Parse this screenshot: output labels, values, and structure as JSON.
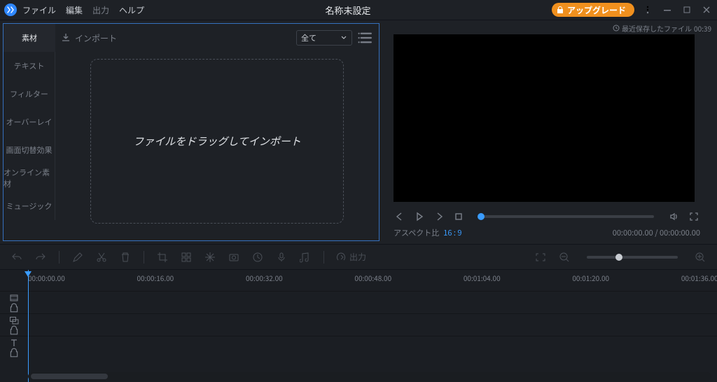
{
  "menubar": {
    "items": [
      "ファイル",
      "編集",
      "出力",
      "ヘルプ"
    ],
    "disabled_index": 2
  },
  "title": "名称未設定",
  "upgrade_label": "アップグレード",
  "recent_saved": {
    "label": "最近保存したファイル",
    "time": "00:39"
  },
  "side_tabs": [
    "素材",
    "テキスト",
    "フィルター",
    "オーバーレイ",
    "画面切替効果",
    "オンライン素材",
    "ミュージック"
  ],
  "active_side_tab": 0,
  "left_panel": {
    "import_label": "インポート",
    "filter_selected": "全て",
    "drop_hint": "ファイルをドラッグしてインポート"
  },
  "player": {
    "aspect_label": "アスペクト比",
    "aspect_value": "16 : 9",
    "time_current": "00:00:00.00",
    "time_total": "00:00:00.00"
  },
  "toolbar": {
    "export_label": "出力"
  },
  "ruler_ticks": [
    {
      "label": "00:00:00.00",
      "pct": 0
    },
    {
      "label": "00:00:16.00",
      "pct": 15.8
    },
    {
      "label": "00:00:32.00",
      "pct": 31.6
    },
    {
      "label": "00:00:48.00",
      "pct": 47.4
    },
    {
      "label": "00:01:04.00",
      "pct": 63.2
    },
    {
      "label": "00:01:20.00",
      "pct": 79.0
    },
    {
      "label": "00:01:36.00",
      "pct": 94.8
    }
  ]
}
